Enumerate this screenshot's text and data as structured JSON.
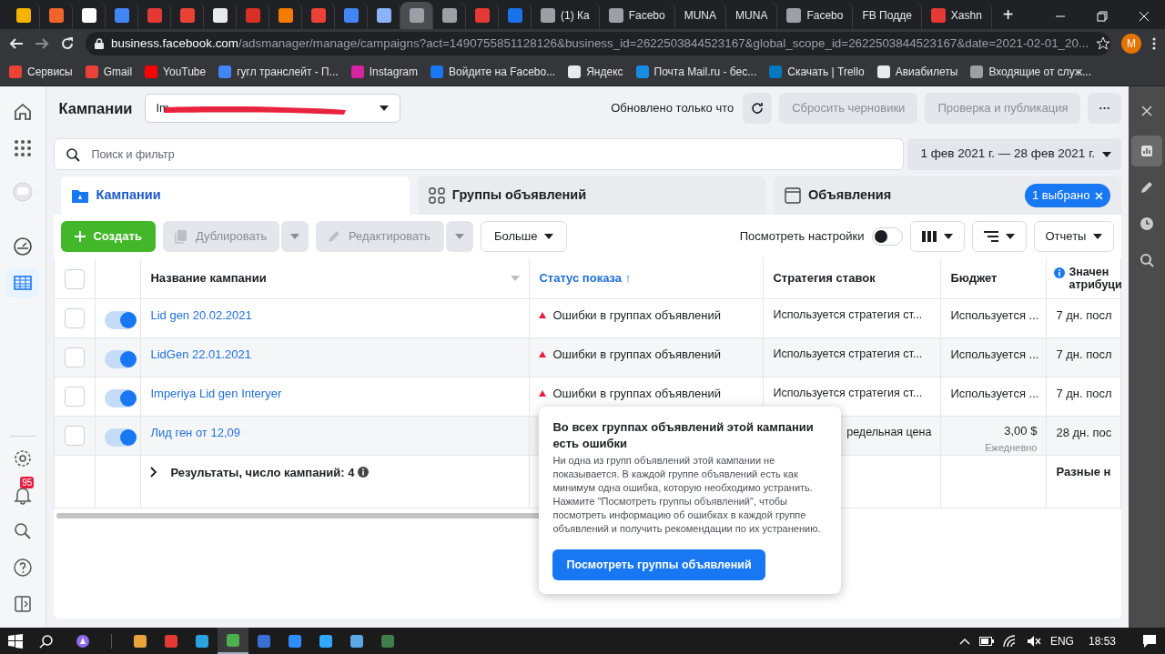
{
  "browser": {
    "tabs": [
      {
        "selected": false,
        "color": "#f4b400"
      },
      {
        "selected": false,
        "color": "#f0642a"
      },
      {
        "selected": false,
        "color": "#ffffff"
      },
      {
        "selected": false,
        "color": "#4285f4"
      },
      {
        "selected": false,
        "color": "#e53935"
      },
      {
        "selected": false,
        "color": "#ea4335"
      },
      {
        "selected": false,
        "color": "#e8eaed"
      },
      {
        "selected": false,
        "color": "#d93025"
      },
      {
        "selected": false,
        "color": "#f57c00"
      },
      {
        "selected": false,
        "color": "#ea4335"
      },
      {
        "selected": false,
        "color": "#4285f4"
      },
      {
        "selected": false,
        "color": "#8ab4f8"
      },
      {
        "selected": true,
        "color": "#9aa0a6"
      },
      {
        "selected": false,
        "color": "#9aa0a6"
      },
      {
        "selected": false,
        "color": "#e53935"
      },
      {
        "selected": false,
        "color": "#1a73e8"
      },
      {
        "selected": false,
        "color": "#9aa0a6",
        "label": "(1) Ка"
      },
      {
        "selected": false,
        "color": "#9aa0a6",
        "label": "Facebo"
      },
      {
        "selected": false,
        "label": "MUNA"
      },
      {
        "selected": false,
        "label": "MUNA"
      },
      {
        "selected": false,
        "color": "#9aa0a6",
        "label": "Facebo"
      },
      {
        "selected": false,
        "label": "FB Подде"
      },
      {
        "selected": false,
        "color": "#e53935",
        "label": "Xashn"
      }
    ],
    "new_tab": "+",
    "url_host": "business.facebook.com",
    "url_path": "/adsmanager/manage/campaigns?act=1490755851128126&business_id=2622503844523167&global_scope_id=2622503844523167&date=2021-02-01_20...",
    "profile": "M",
    "bookmarks": [
      {
        "label": "Сервисы",
        "color": "#ea4335"
      },
      {
        "label": "Gmail",
        "color": "#ea4335"
      },
      {
        "label": "YouTube",
        "color": "#ff0000"
      },
      {
        "label": "гугл транслейт - П...",
        "color": "#4285f4"
      },
      {
        "label": "Instagram",
        "color": "#d6249f"
      },
      {
        "label": "Войдите на Facebo...",
        "color": "#1877f2"
      },
      {
        "label": "Яндекс",
        "color": "#e8eaed"
      },
      {
        "label": "Почта Mail.ru - бес...",
        "color": "#168de2"
      },
      {
        "label": "Скачать | Trello",
        "color": "#0079bf"
      },
      {
        "label": "Авиабилеты",
        "color": "#e8eaed"
      },
      {
        "label": "Входящие от служ...",
        "color": "#9aa0a6"
      }
    ]
  },
  "left_rail": {
    "items": [
      {
        "kind": "home",
        "selected": false
      },
      {
        "kind": "apps",
        "selected": false
      },
      {
        "kind": "account",
        "selected": false
      },
      {
        "kind": "gauge",
        "selected": false
      },
      {
        "kind": "table",
        "selected": true
      }
    ],
    "bottom": [
      {
        "kind": "settings"
      },
      {
        "kind": "bell",
        "badge": "95"
      },
      {
        "kind": "search"
      },
      {
        "kind": "help"
      },
      {
        "kind": "panel"
      }
    ]
  },
  "header": {
    "title": "Кампании",
    "account": "Im",
    "updated": "Обновлено только что",
    "discard": {
      "label": "Сбросить черновики",
      "disabled": true
    },
    "publish": {
      "label": "Проверка и публикация",
      "disabled": true
    },
    "more": "···"
  },
  "search": {
    "placeholder": "Поиск и фильтр"
  },
  "date_range": "1 фев 2021 г. — 28 фев 2021 г.",
  "levels": [
    {
      "label": "Кампании",
      "selected": true
    },
    {
      "label": "Группы объявлений",
      "selected": false
    },
    {
      "label": "Объявления",
      "selected": false,
      "chip": "1 выбрано"
    }
  ],
  "toolbar": {
    "create": "Создать",
    "duplicate": {
      "label": "Дублировать",
      "disabled": true
    },
    "edit": {
      "label": "Редактировать",
      "disabled": true
    },
    "more": "Больше",
    "view_setup": {
      "label": "Посмотреть настройки",
      "on": false
    },
    "reports": "Отчеты"
  },
  "table": {
    "columns": [
      "Название кампании",
      "Статус показа ↑",
      "Стратегия ставок",
      "Бюджет",
      "Значен атрибуци"
    ],
    "select_all_checked": false,
    "rows": [
      {
        "checked": false,
        "on": true,
        "name": "Lid gen 20.02.2021",
        "status": "Ошибки в группах объявлений",
        "strategy": "Используется стратегия ст...",
        "budget": "Используется ...",
        "attribution": "7 дн. посл"
      },
      {
        "checked": false,
        "on": true,
        "name": "LidGen 22.01.2021",
        "status": "Ошибки в группах объявлений",
        "strategy": "Используется стратегия ст...",
        "budget": "Используется ...",
        "attribution": "7 дн. посл"
      },
      {
        "checked": false,
        "on": true,
        "name": "Imperiya Lid gen Interyer",
        "status": "Ошибки в группах объявлений",
        "strategy": "Используется стратегия ст...",
        "budget": "Используется ...",
        "attribution": "7 дн. посл"
      },
      {
        "checked": false,
        "on": true,
        "name": "Лид ген от 12,09",
        "strategy": "редельная цена",
        "budget": "3,00 $",
        "budget_period": "Ежедневно",
        "attribution": "28 дн. пос"
      }
    ],
    "summary": "Результаты, число кампаний: 4",
    "summary_attribution": "Разные н"
  },
  "popover": {
    "title": "Во всех группах объявлений этой кампании есть ошибки",
    "body": "Ни одна из групп объявлений этой кампании не показывается. В каждой группе объявлений есть как минимум одна ошибка, которую необходимо устранить. Нажмите \"Посмотреть группы объявлений\", чтобы посмотреть информацию об ошибках в каждой группе объявлений и получить рекомендации по их устранению.",
    "button": "Посмотреть группы объявлений"
  },
  "right_rail": [
    {
      "kind": "close",
      "selected": false
    },
    {
      "kind": "chart",
      "selected": true
    },
    {
      "kind": "pencil",
      "selected": false
    },
    {
      "kind": "clock",
      "selected": false
    },
    {
      "kind": "search",
      "selected": false
    }
  ],
  "taskbar": {
    "apps": [
      {
        "color": "#e8a33d",
        "selected": false
      },
      {
        "color": "#e53935",
        "selected": false
      },
      {
        "color": "#2aa3e0",
        "selected": false
      },
      {
        "color": "#4caf50",
        "selected": true
      },
      {
        "color": "#3b6fd8",
        "selected": false
      },
      {
        "color": "#2d8cff",
        "selected": false
      },
      {
        "color": "#31a8ff",
        "selected": false
      },
      {
        "color": "#5aa9e6",
        "selected": false
      },
      {
        "color": "#3f7d4a",
        "selected": false
      }
    ],
    "language": "ENG",
    "time": "18:53"
  }
}
